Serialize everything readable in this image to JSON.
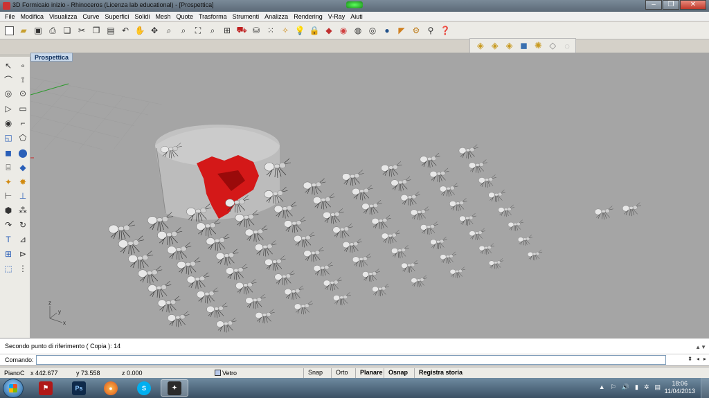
{
  "window": {
    "title": "3D Formicaio inizio  - Rhinoceros (Licenza lab educational) - [Prospettica]",
    "minimize": "–",
    "maximize": "❐",
    "close": "✕"
  },
  "menu": [
    "File",
    "Modifica",
    "Visualizza",
    "Curve",
    "Superfici",
    "Solidi",
    "Mesh",
    "Quote",
    "Trasforma",
    "Strumenti",
    "Analizza",
    "Rendering",
    "V-Ray",
    "Aiuti"
  ],
  "viewport": {
    "label": "Prospettica",
    "axes": {
      "z": "z",
      "y": "y",
      "x": "x"
    }
  },
  "command": {
    "history_text": "Secondo punto di riferimento ( Copia ): 14",
    "prompt_label": "Comando:",
    "input_value": ""
  },
  "status": {
    "cplane": "PianoC",
    "x": "x 442.677",
    "y": "y 73.558",
    "z": "z 0.000",
    "layer": "Vetro",
    "snap": "Snap",
    "orto": "Orto",
    "planare": "Planare",
    "osnap": "Osnap",
    "history": "Registra storia"
  },
  "taskbar": {
    "clock_time": "18:06",
    "clock_date": "11/04/2013",
    "ps_label": "Ps"
  },
  "colors": {
    "viewport_bg": "#a5a5a5",
    "red_object": "#d41818",
    "ant_body": "#e8e8e8"
  }
}
